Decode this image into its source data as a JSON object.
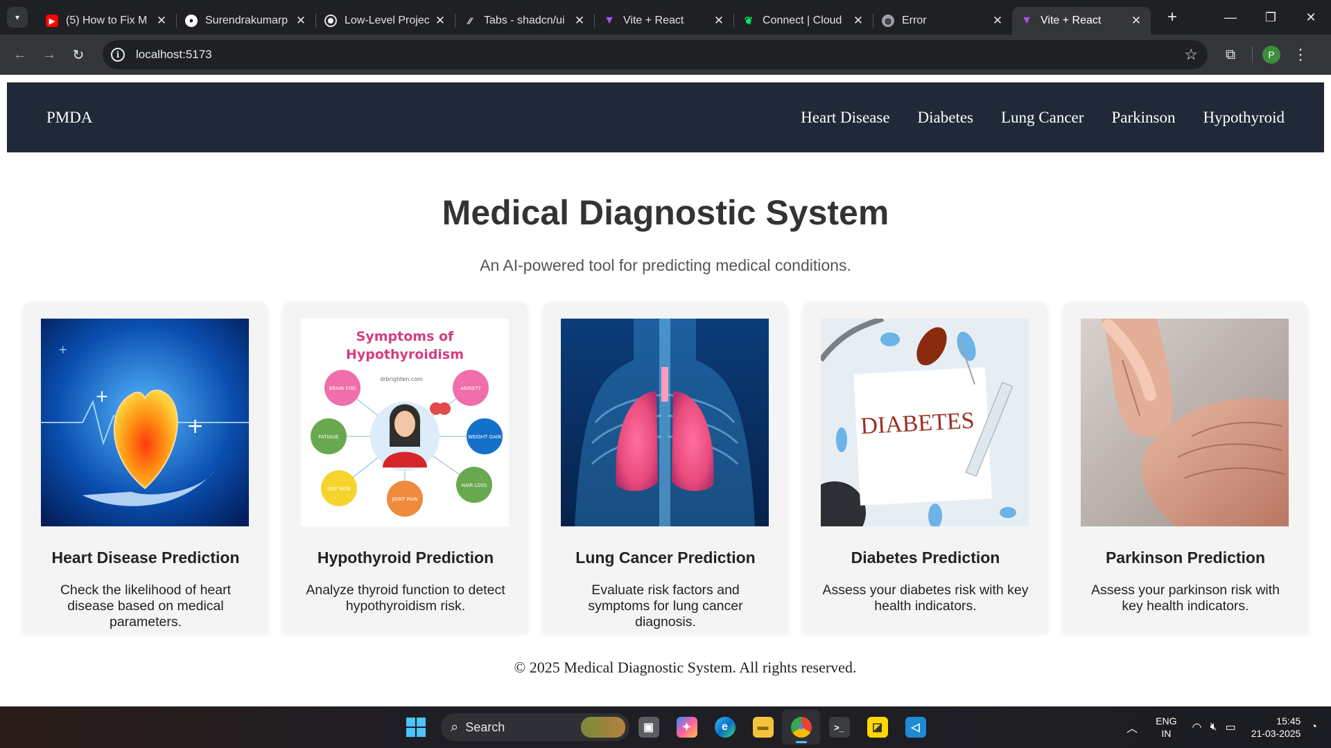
{
  "browser": {
    "tabs": [
      {
        "title": "(5) How to Fix M",
        "icon": "youtube-icon",
        "color": "#ff0000",
        "active": false
      },
      {
        "title": "Surendrakumarp",
        "icon": "github-icon",
        "color": "#ffffff",
        "active": false
      },
      {
        "title": "Low-Level Projec",
        "icon": "chatgpt-icon",
        "color": "#ffffff",
        "active": false
      },
      {
        "title": "Tabs - shadcn/ui",
        "icon": "shadcn-icon",
        "color": "#ffffff",
        "active": false
      },
      {
        "title": "Vite + React",
        "icon": "vite-icon",
        "color": "#a855f7",
        "active": false
      },
      {
        "title": "Connect | Cloud",
        "icon": "mongodb-leaf-icon",
        "color": "#00ed64",
        "active": false
      },
      {
        "title": "Error",
        "icon": "globe-icon",
        "color": "#9aa0a6",
        "active": false
      },
      {
        "title": "Vite + React",
        "icon": "vite-icon",
        "color": "#a855f7",
        "active": true
      }
    ],
    "url": "localhost:5173",
    "profile_initial": "P"
  },
  "site": {
    "brand": "PMDA",
    "nav": [
      "Heart Disease",
      "Diabetes",
      "Lung Cancer",
      "Parkinson",
      "Hypothyroid"
    ],
    "title": "Medical Diagnostic System",
    "subtitle": "An AI-powered tool for predicting medical conditions.",
    "cards": [
      {
        "title": "Heart Disease Prediction",
        "desc": "Check the likelihood of heart disease based on medical parameters.",
        "image": "heart-illustration"
      },
      {
        "title": "Hypothyroid Prediction",
        "desc": "Analyze thyroid function to detect hypothyroidism risk.",
        "image": "hypothyroid-symptoms-infographic",
        "infographic": {
          "heading_line1": "Symptoms of",
          "heading_line2": "Hypothyroidism",
          "source": "drbrighten.com",
          "bubbles": [
            "BRAIN FOG",
            "ANXIETY",
            "FATIGUE",
            "WEIGHT GAIN",
            "DRY SKIN",
            "JOINT PAIN",
            "HAIR LOSS"
          ]
        }
      },
      {
        "title": "Lung Cancer Prediction",
        "desc": "Evaluate risk factors and symptoms for lung cancer diagnosis.",
        "image": "lungs-xray-illustration"
      },
      {
        "title": "Diabetes Prediction",
        "desc": "Assess your diabetes risk with key health indicators.",
        "image": "diabetes-note-photo",
        "photo_text": "DIABETES"
      },
      {
        "title": "Parkinson Prediction",
        "desc": "Assess your parkinson risk with key health indicators.",
        "image": "elderly-hands-photo"
      }
    ],
    "footer": "© 2025 Medical Diagnostic System. All rights reserved."
  },
  "taskbar": {
    "search_label": "Search",
    "lang_line1": "ENG",
    "lang_line2": "IN",
    "time": "15:45",
    "date": "21-03-2025"
  }
}
